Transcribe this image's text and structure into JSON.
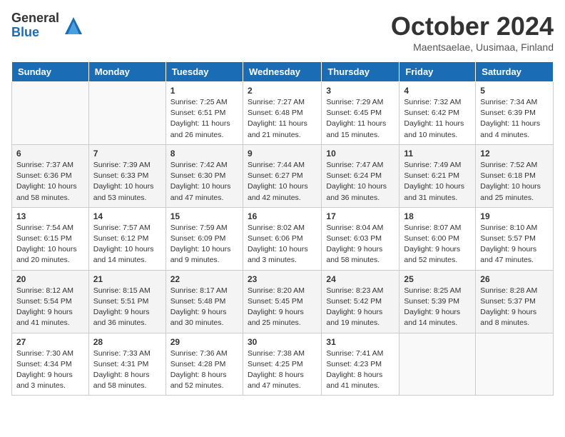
{
  "logo": {
    "general": "General",
    "blue": "Blue"
  },
  "title": "October 2024",
  "location": "Maentsaelae, Uusimaa, Finland",
  "days_of_week": [
    "Sunday",
    "Monday",
    "Tuesday",
    "Wednesday",
    "Thursday",
    "Friday",
    "Saturday"
  ],
  "weeks": [
    [
      {
        "day": "",
        "info": ""
      },
      {
        "day": "",
        "info": ""
      },
      {
        "day": "1",
        "info": "Sunrise: 7:25 AM\nSunset: 6:51 PM\nDaylight: 11 hours\nand 26 minutes."
      },
      {
        "day": "2",
        "info": "Sunrise: 7:27 AM\nSunset: 6:48 PM\nDaylight: 11 hours\nand 21 minutes."
      },
      {
        "day": "3",
        "info": "Sunrise: 7:29 AM\nSunset: 6:45 PM\nDaylight: 11 hours\nand 15 minutes."
      },
      {
        "day": "4",
        "info": "Sunrise: 7:32 AM\nSunset: 6:42 PM\nDaylight: 11 hours\nand 10 minutes."
      },
      {
        "day": "5",
        "info": "Sunrise: 7:34 AM\nSunset: 6:39 PM\nDaylight: 11 hours\nand 4 minutes."
      }
    ],
    [
      {
        "day": "6",
        "info": "Sunrise: 7:37 AM\nSunset: 6:36 PM\nDaylight: 10 hours\nand 58 minutes."
      },
      {
        "day": "7",
        "info": "Sunrise: 7:39 AM\nSunset: 6:33 PM\nDaylight: 10 hours\nand 53 minutes."
      },
      {
        "day": "8",
        "info": "Sunrise: 7:42 AM\nSunset: 6:30 PM\nDaylight: 10 hours\nand 47 minutes."
      },
      {
        "day": "9",
        "info": "Sunrise: 7:44 AM\nSunset: 6:27 PM\nDaylight: 10 hours\nand 42 minutes."
      },
      {
        "day": "10",
        "info": "Sunrise: 7:47 AM\nSunset: 6:24 PM\nDaylight: 10 hours\nand 36 minutes."
      },
      {
        "day": "11",
        "info": "Sunrise: 7:49 AM\nSunset: 6:21 PM\nDaylight: 10 hours\nand 31 minutes."
      },
      {
        "day": "12",
        "info": "Sunrise: 7:52 AM\nSunset: 6:18 PM\nDaylight: 10 hours\nand 25 minutes."
      }
    ],
    [
      {
        "day": "13",
        "info": "Sunrise: 7:54 AM\nSunset: 6:15 PM\nDaylight: 10 hours\nand 20 minutes."
      },
      {
        "day": "14",
        "info": "Sunrise: 7:57 AM\nSunset: 6:12 PM\nDaylight: 10 hours\nand 14 minutes."
      },
      {
        "day": "15",
        "info": "Sunrise: 7:59 AM\nSunset: 6:09 PM\nDaylight: 10 hours\nand 9 minutes."
      },
      {
        "day": "16",
        "info": "Sunrise: 8:02 AM\nSunset: 6:06 PM\nDaylight: 10 hours\nand 3 minutes."
      },
      {
        "day": "17",
        "info": "Sunrise: 8:04 AM\nSunset: 6:03 PM\nDaylight: 9 hours\nand 58 minutes."
      },
      {
        "day": "18",
        "info": "Sunrise: 8:07 AM\nSunset: 6:00 PM\nDaylight: 9 hours\nand 52 minutes."
      },
      {
        "day": "19",
        "info": "Sunrise: 8:10 AM\nSunset: 5:57 PM\nDaylight: 9 hours\nand 47 minutes."
      }
    ],
    [
      {
        "day": "20",
        "info": "Sunrise: 8:12 AM\nSunset: 5:54 PM\nDaylight: 9 hours\nand 41 minutes."
      },
      {
        "day": "21",
        "info": "Sunrise: 8:15 AM\nSunset: 5:51 PM\nDaylight: 9 hours\nand 36 minutes."
      },
      {
        "day": "22",
        "info": "Sunrise: 8:17 AM\nSunset: 5:48 PM\nDaylight: 9 hours\nand 30 minutes."
      },
      {
        "day": "23",
        "info": "Sunrise: 8:20 AM\nSunset: 5:45 PM\nDaylight: 9 hours\nand 25 minutes."
      },
      {
        "day": "24",
        "info": "Sunrise: 8:23 AM\nSunset: 5:42 PM\nDaylight: 9 hours\nand 19 minutes."
      },
      {
        "day": "25",
        "info": "Sunrise: 8:25 AM\nSunset: 5:39 PM\nDaylight: 9 hours\nand 14 minutes."
      },
      {
        "day": "26",
        "info": "Sunrise: 8:28 AM\nSunset: 5:37 PM\nDaylight: 9 hours\nand 8 minutes."
      }
    ],
    [
      {
        "day": "27",
        "info": "Sunrise: 7:30 AM\nSunset: 4:34 PM\nDaylight: 9 hours\nand 3 minutes."
      },
      {
        "day": "28",
        "info": "Sunrise: 7:33 AM\nSunset: 4:31 PM\nDaylight: 8 hours\nand 58 minutes."
      },
      {
        "day": "29",
        "info": "Sunrise: 7:36 AM\nSunset: 4:28 PM\nDaylight: 8 hours\nand 52 minutes."
      },
      {
        "day": "30",
        "info": "Sunrise: 7:38 AM\nSunset: 4:25 PM\nDaylight: 8 hours\nand 47 minutes."
      },
      {
        "day": "31",
        "info": "Sunrise: 7:41 AM\nSunset: 4:23 PM\nDaylight: 8 hours\nand 41 minutes."
      },
      {
        "day": "",
        "info": ""
      },
      {
        "day": "",
        "info": ""
      }
    ]
  ]
}
